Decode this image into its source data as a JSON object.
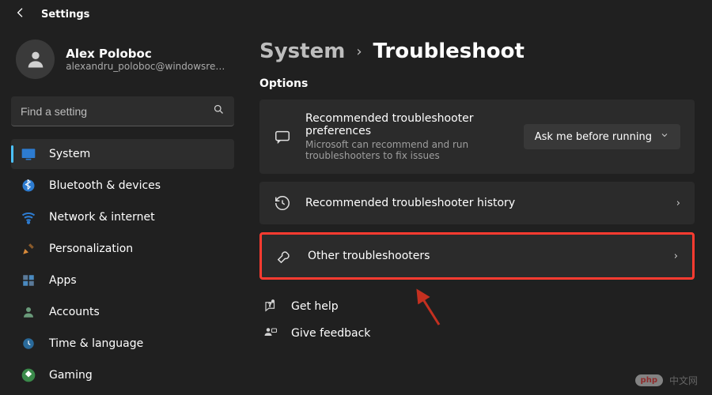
{
  "header": {
    "app_title": "Settings"
  },
  "user": {
    "name": "Alex Poloboc",
    "email": "alexandru_poloboc@windowsreport..."
  },
  "search": {
    "placeholder": "Find a setting"
  },
  "sidebar": {
    "items": [
      {
        "icon": "system",
        "label": "System",
        "active": true
      },
      {
        "icon": "bluetooth",
        "label": "Bluetooth & devices",
        "active": false
      },
      {
        "icon": "network",
        "label": "Network & internet",
        "active": false
      },
      {
        "icon": "personalization",
        "label": "Personalization",
        "active": false
      },
      {
        "icon": "apps",
        "label": "Apps",
        "active": false
      },
      {
        "icon": "accounts",
        "label": "Accounts",
        "active": false
      },
      {
        "icon": "time",
        "label": "Time & language",
        "active": false
      },
      {
        "icon": "gaming",
        "label": "Gaming",
        "active": false
      }
    ]
  },
  "breadcrumb": {
    "parent": "System",
    "current": "Troubleshoot"
  },
  "section_title": "Options",
  "cards": {
    "recommended": {
      "title": "Recommended troubleshooter preferences",
      "subtitle": "Microsoft can recommend and run troubleshooters to fix issues",
      "select_value": "Ask me before running"
    },
    "history": {
      "title": "Recommended troubleshooter history"
    },
    "other": {
      "title": "Other troubleshooters"
    }
  },
  "help": {
    "get_help": "Get help",
    "feedback": "Give feedback"
  },
  "watermark": {
    "badge": "php",
    "text": "中文网"
  }
}
